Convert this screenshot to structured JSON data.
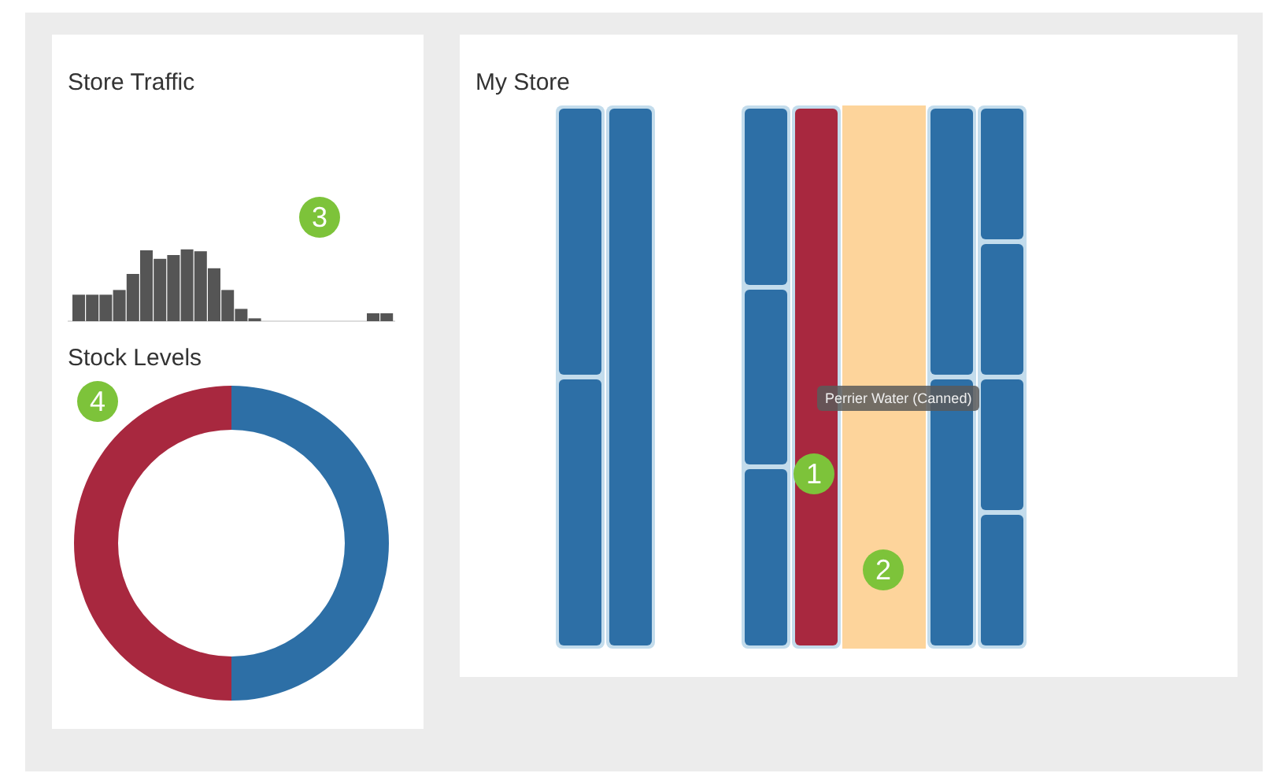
{
  "traffic_panel": {
    "title": "Store Traffic",
    "badge": "3"
  },
  "stock_panel": {
    "title": "Stock Levels",
    "badge": "4"
  },
  "store_panel": {
    "title": "My Store",
    "units": [
      {
        "kind": "shelf",
        "segments": [
          {
            "highlighted": false
          },
          {
            "highlighted": false
          }
        ]
      },
      {
        "kind": "shelf",
        "segments": [
          {
            "highlighted": false
          }
        ]
      },
      {
        "kind": "gap"
      },
      {
        "kind": "shelf",
        "segments": [
          {
            "highlighted": false
          },
          {
            "highlighted": false
          },
          {
            "highlighted": false
          }
        ]
      },
      {
        "kind": "shelf",
        "segments": [
          {
            "highlighted": true
          }
        ],
        "badge": "1",
        "tooltip": "Perrier Water (Canned)"
      },
      {
        "kind": "aisle",
        "badge": "2"
      },
      {
        "kind": "shelf",
        "segments": [
          {
            "highlighted": false
          },
          {
            "highlighted": false
          }
        ]
      },
      {
        "kind": "shelf",
        "segments": [
          {
            "highlighted": false
          },
          {
            "highlighted": false
          },
          {
            "highlighted": false
          },
          {
            "highlighted": false
          }
        ]
      }
    ]
  }
}
